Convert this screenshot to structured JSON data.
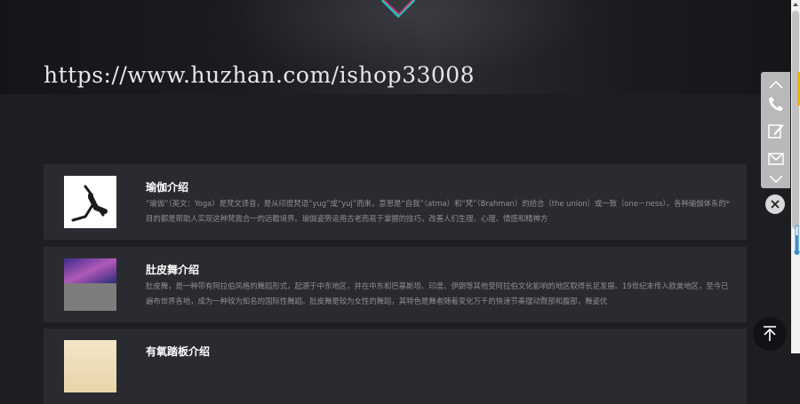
{
  "banner": {
    "watermark": "https://www.huzhan.com/ishop33008"
  },
  "cards": [
    {
      "title": "瑜伽介绍",
      "description": "“瑜伽”（英文：Yoga）是梵文译音，是从印度梵语“yug”或“yuj”而来，意思是“自我”（atma）和“梵”（Brahman）的结合（the union）或一致（one－ness）。各种瑜伽体系的*目的都是帮助人实现这种梵我合一的远瞻境界。瑜伽姿势运用古老而易于掌握的技巧，改善人们生理、心理、情感和精神方"
    },
    {
      "title": "肚皮舞介绍",
      "description": "肚皮舞，是一种带有阿拉伯风格的舞蹈形式，起源于中东地区，并在中东和巴基斯坦、印度、伊朗等其他受阿拉伯文化影响的地区取得长足发展。19世纪末传入欧美地区，至今已遍布世界各地，成为一种较为知名的国际性舞蹈。肚皮舞是较为女性的舞蹈，其特色是舞者随着变化万千的快速节奏摆动臀部和腹部，舞姿优"
    },
    {
      "title": "有氧踏板介绍",
      "description": ""
    }
  ],
  "toolbar": {
    "icons": [
      "chevron-up-icon",
      "phone-icon",
      "edit-icon",
      "mail-icon",
      "chevron-down-icon"
    ]
  },
  "colors": {
    "background": "#1d1e22",
    "card": "#2a2b30",
    "title": "#ffffff",
    "text": "#8e8f94",
    "toolbar": "#b9b9bb",
    "accent": "#f0b400"
  }
}
